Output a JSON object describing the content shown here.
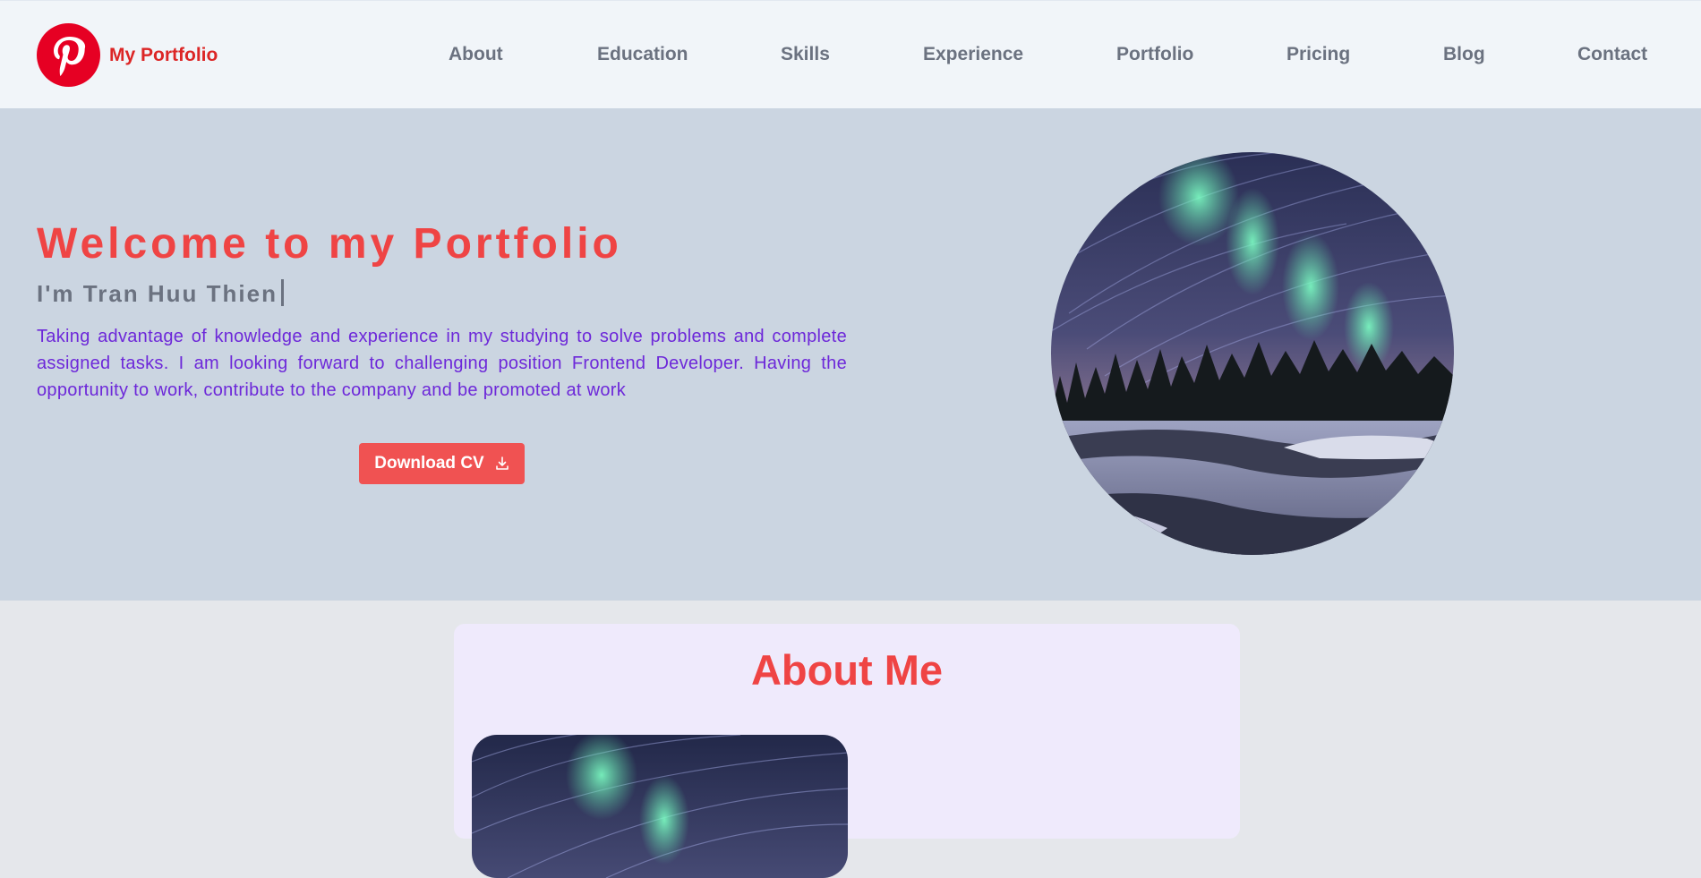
{
  "brand": {
    "name": "My Portfolio",
    "logo_icon": "pinterest-icon",
    "logo_color": "#e60023"
  },
  "nav": {
    "items": [
      {
        "label": "About"
      },
      {
        "label": "Education"
      },
      {
        "label": "Skills"
      },
      {
        "label": "Experience"
      },
      {
        "label": "Portfolio"
      },
      {
        "label": "Pricing"
      },
      {
        "label": "Blog"
      },
      {
        "label": "Contact"
      }
    ]
  },
  "hero": {
    "title": "Welcome to my Portfolio",
    "subtitle": "I'm Tran Huu Thien",
    "description": "Taking advantage of knowledge and experience in my studying to solve problems and complete assigned tasks. I am looking forward to challenging position Frontend Developer. Having the opportunity to work, contribute to the company and be promoted at work",
    "download_label": "Download CV",
    "download_icon": "download-icon"
  },
  "about": {
    "title": "About Me"
  },
  "colors": {
    "accent": "#ef4444",
    "brand_red": "#dc2626",
    "description_purple": "#6d28d9",
    "nav_gray": "#6b7280",
    "hero_bg": "#cbd5e1",
    "header_bg": "#f1f5f9"
  }
}
